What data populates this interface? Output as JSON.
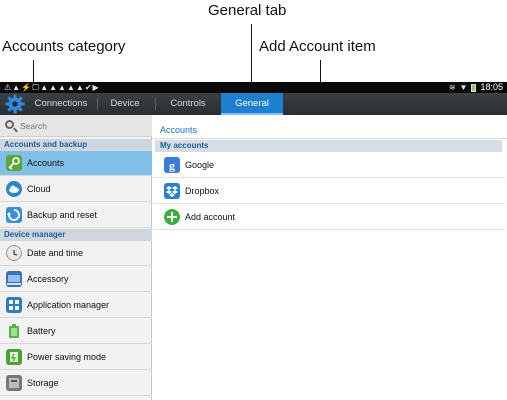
{
  "callouts": {
    "general_tab": "General tab",
    "accounts_category": "Accounts category",
    "add_account_item": "Add Account item"
  },
  "statusbar": {
    "time": "18:05"
  },
  "tabs": [
    {
      "label": "Connections",
      "active": false
    },
    {
      "label": "Device",
      "active": false
    },
    {
      "label": "Controls",
      "active": false
    },
    {
      "label": "General",
      "active": true
    }
  ],
  "sidebar": {
    "search_placeholder": "Search",
    "sections": [
      {
        "header": "Accounts and backup"
      },
      {
        "header": "Device manager"
      }
    ],
    "items": [
      {
        "label": "Accounts",
        "icon": "key-icon",
        "color": "#5aa83a",
        "selected": true
      },
      {
        "label": "Cloud",
        "icon": "cloud-icon",
        "color": "#2a86cf"
      },
      {
        "label": "Backup and reset",
        "icon": "backup-icon",
        "color": "#3b8fd6"
      },
      {
        "label": "Date and time",
        "icon": "clock-icon",
        "color": "#9a9a9a"
      },
      {
        "label": "Accessory",
        "icon": "accessory-icon",
        "color": "#3d6fb3"
      },
      {
        "label": "Application manager",
        "icon": "app-grid-icon",
        "color": "#2f7cc4"
      },
      {
        "label": "Battery",
        "icon": "battery-icon",
        "color": "#55b34a"
      },
      {
        "label": "Power saving mode",
        "icon": "power-saving-icon",
        "color": "#4aa23b"
      },
      {
        "label": "Storage",
        "icon": "storage-icon",
        "color": "#777777"
      }
    ]
  },
  "main": {
    "breadcrumb": "Accounts",
    "subheader": "My accounts",
    "accounts": [
      {
        "label": "Google",
        "icon": "google-icon",
        "color": "#3b7bdc"
      },
      {
        "label": "Dropbox",
        "icon": "dropbox-icon",
        "color": "#2b7fd4"
      }
    ],
    "add_account_label": "Add account",
    "add_color": "#3cae3a"
  }
}
